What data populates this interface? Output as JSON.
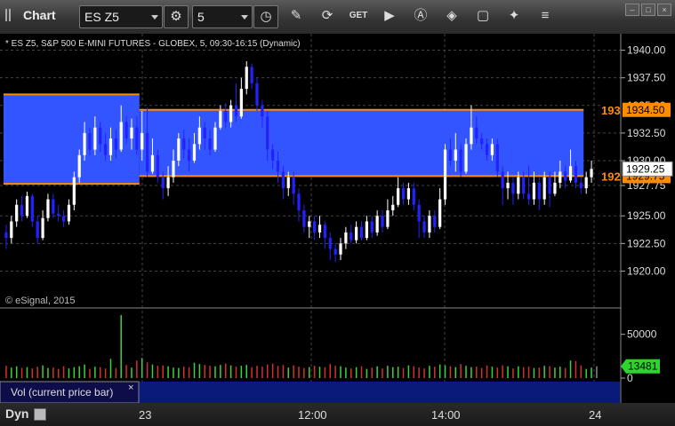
{
  "toolbar": {
    "title": "Chart",
    "symbol": "ES Z5",
    "interval": "5",
    "icons": [
      "settings-gear-icon",
      "clock-icon",
      "pencil-icon",
      "refresh-icon",
      "get-icon",
      "play-icon",
      "alert-icon",
      "tag-icon",
      "chat-icon",
      "twitter-icon",
      "menu-icon"
    ]
  },
  "chart_data": {
    "type": "candlestick",
    "title": "* ES Z5, S&P 500 E-MINI FUTURES - GLOBEX, 5, 09:30-16:15 (Dynamic)",
    "watermark": "© eSignal, 2015",
    "ylim": [
      1918.75,
      1941.25
    ],
    "yticks": [
      "1940.00",
      "1937.50",
      "1935.00",
      "1932.50",
      "1930.00",
      "1927.75",
      "1925.00",
      "1922.50",
      "1920.00"
    ],
    "xticks": [
      "23",
      "12:00",
      "14:00",
      "24"
    ],
    "last_price": "1929.25",
    "level_tag_top": "193",
    "level_tag_top_value": "1934.50",
    "level_tag_bottom": "192",
    "level_tag_bottom_value": "1929.75",
    "zones": [
      {
        "x_start": 0,
        "x_end": 26,
        "top": 1936.0,
        "bottom": 1927.9
      },
      {
        "x_start": 26,
        "x_end": 111,
        "top": 1934.6,
        "bottom": 1928.6
      }
    ],
    "candles": [
      [
        1923.5,
        1923.0,
        1924.2,
        1922.0
      ],
      [
        1923.0,
        1924.5,
        1925.0,
        1922.5
      ],
      [
        1924.5,
        1926.0,
        1926.5,
        1924.0
      ],
      [
        1926.0,
        1925.0,
        1926.8,
        1924.5
      ],
      [
        1925.0,
        1926.8,
        1927.2,
        1924.8
      ],
      [
        1926.8,
        1924.5,
        1927.0,
        1924.0
      ],
      [
        1924.5,
        1923.0,
        1925.0,
        1922.5
      ],
      [
        1923.0,
        1924.8,
        1925.5,
        1922.8
      ],
      [
        1924.8,
        1926.5,
        1927.0,
        1924.5
      ],
      [
        1926.5,
        1925.2,
        1927.0,
        1924.8
      ],
      [
        1925.2,
        1925.0,
        1926.0,
        1924.5
      ],
      [
        1925.0,
        1924.5,
        1925.5,
        1924.0
      ],
      [
        1924.5,
        1926.0,
        1926.5,
        1924.2
      ],
      [
        1926.0,
        1928.5,
        1929.0,
        1925.5
      ],
      [
        1928.5,
        1930.5,
        1931.0,
        1928.0
      ],
      [
        1930.5,
        1932.5,
        1933.5,
        1930.0
      ],
      [
        1932.5,
        1931.0,
        1933.0,
        1930.5
      ],
      [
        1931.0,
        1933.0,
        1934.0,
        1930.5
      ],
      [
        1933.0,
        1931.5,
        1933.5,
        1930.8
      ],
      [
        1931.5,
        1930.5,
        1932.5,
        1930.0
      ],
      [
        1930.5,
        1932.0,
        1933.0,
        1930.0
      ],
      [
        1932.0,
        1931.0,
        1932.8,
        1930.2
      ],
      [
        1931.0,
        1933.5,
        1935.0,
        1930.8
      ],
      [
        1933.5,
        1932.0,
        1934.0,
        1931.5
      ],
      [
        1932.0,
        1933.0,
        1933.8,
        1931.0
      ],
      [
        1933.0,
        1931.0,
        1934.0,
        1930.5
      ],
      [
        1931.0,
        1932.5,
        1934.5,
        1930.0
      ],
      [
        1932.5,
        1929.0,
        1934.8,
        1928.5
      ],
      [
        1929.0,
        1930.5,
        1932.0,
        1928.8
      ],
      [
        1930.5,
        1928.5,
        1931.0,
        1928.0
      ],
      [
        1928.5,
        1927.5,
        1929.0,
        1926.5
      ],
      [
        1927.5,
        1928.5,
        1929.5,
        1926.8
      ],
      [
        1928.5,
        1930.0,
        1931.0,
        1928.0
      ],
      [
        1930.0,
        1932.0,
        1932.5,
        1929.5
      ],
      [
        1932.0,
        1931.0,
        1932.8,
        1930.2
      ],
      [
        1931.0,
        1930.0,
        1932.0,
        1929.0
      ],
      [
        1930.0,
        1931.5,
        1932.5,
        1929.8
      ],
      [
        1931.5,
        1933.0,
        1934.0,
        1931.0
      ],
      [
        1933.0,
        1932.0,
        1933.5,
        1931.0
      ],
      [
        1932.0,
        1931.0,
        1932.8,
        1930.5
      ],
      [
        1931.0,
        1933.0,
        1933.5,
        1930.8
      ],
      [
        1933.0,
        1934.5,
        1935.0,
        1932.8
      ],
      [
        1934.5,
        1933.5,
        1935.2,
        1933.0
      ],
      [
        1933.5,
        1935.0,
        1935.5,
        1933.0
      ],
      [
        1935.0,
        1934.0,
        1937.0,
        1933.5
      ],
      [
        1934.0,
        1936.5,
        1937.5,
        1933.8
      ],
      [
        1936.5,
        1938.5,
        1939.0,
        1936.0
      ],
      [
        1938.5,
        1937.0,
        1938.8,
        1936.5
      ],
      [
        1937.0,
        1935.0,
        1937.5,
        1934.5
      ],
      [
        1935.0,
        1934.0,
        1935.5,
        1933.0
      ],
      [
        1934.0,
        1931.0,
        1934.5,
        1930.0
      ],
      [
        1931.0,
        1930.0,
        1931.5,
        1929.2
      ],
      [
        1930.0,
        1929.0,
        1930.8,
        1928.0
      ],
      [
        1929.0,
        1927.5,
        1929.5,
        1926.5
      ],
      [
        1927.5,
        1928.5,
        1929.0,
        1926.8
      ],
      [
        1928.5,
        1927.0,
        1929.0,
        1926.0
      ],
      [
        1927.0,
        1925.5,
        1927.5,
        1924.5
      ],
      [
        1925.5,
        1924.0,
        1926.0,
        1923.5
      ],
      [
        1924.0,
        1924.5,
        1925.0,
        1923.0
      ],
      [
        1924.5,
        1923.5,
        1925.0,
        1922.8
      ],
      [
        1923.5,
        1924.2,
        1925.0,
        1923.0
      ],
      [
        1924.2,
        1923.0,
        1924.5,
        1922.0
      ],
      [
        1923.0,
        1922.0,
        1923.5,
        1921.0
      ],
      [
        1922.0,
        1921.5,
        1922.5,
        1920.8
      ],
      [
        1921.5,
        1922.5,
        1923.0,
        1921.0
      ],
      [
        1922.5,
        1923.5,
        1924.0,
        1922.0
      ],
      [
        1923.5,
        1922.8,
        1924.2,
        1922.5
      ],
      [
        1922.8,
        1924.0,
        1924.5,
        1922.5
      ],
      [
        1924.0,
        1923.0,
        1924.5,
        1922.8
      ],
      [
        1923.0,
        1924.5,
        1925.0,
        1922.8
      ],
      [
        1924.5,
        1923.5,
        1925.0,
        1923.0
      ],
      [
        1923.5,
        1925.0,
        1925.5,
        1923.2
      ],
      [
        1925.0,
        1924.0,
        1925.5,
        1923.5
      ],
      [
        1924.0,
        1925.5,
        1926.5,
        1923.8
      ],
      [
        1925.5,
        1926.0,
        1926.8,
        1925.0
      ],
      [
        1926.0,
        1927.5,
        1928.5,
        1925.8
      ],
      [
        1927.5,
        1926.5,
        1928.0,
        1926.0
      ],
      [
        1926.5,
        1927.5,
        1928.0,
        1926.0
      ],
      [
        1927.5,
        1926.0,
        1928.0,
        1925.5
      ],
      [
        1926.0,
        1924.5,
        1926.5,
        1923.0
      ],
      [
        1924.5,
        1923.5,
        1925.0,
        1923.0
      ],
      [
        1923.5,
        1925.0,
        1925.5,
        1923.0
      ],
      [
        1925.0,
        1924.0,
        1925.5,
        1923.5
      ],
      [
        1924.0,
        1926.5,
        1927.5,
        1923.8
      ],
      [
        1926.5,
        1931.0,
        1931.5,
        1926.0
      ],
      [
        1931.0,
        1930.0,
        1932.0,
        1929.5
      ],
      [
        1930.0,
        1931.0,
        1932.5,
        1929.0
      ],
      [
        1931.0,
        1929.0,
        1931.5,
        1928.5
      ],
      [
        1929.0,
        1931.5,
        1932.0,
        1928.8
      ],
      [
        1931.5,
        1933.0,
        1935.0,
        1931.0
      ],
      [
        1933.0,
        1932.0,
        1934.0,
        1931.5
      ],
      [
        1932.0,
        1931.5,
        1932.5,
        1931.0
      ],
      [
        1931.5,
        1930.5,
        1932.0,
        1930.0
      ],
      [
        1930.5,
        1931.5,
        1932.0,
        1930.0
      ],
      [
        1931.5,
        1929.0,
        1932.0,
        1928.5
      ],
      [
        1929.0,
        1927.5,
        1929.5,
        1926.0
      ],
      [
        1927.5,
        1928.0,
        1929.0,
        1926.5
      ],
      [
        1928.0,
        1927.0,
        1928.5,
        1926.0
      ],
      [
        1927.0,
        1928.5,
        1929.0,
        1926.5
      ],
      [
        1928.5,
        1927.0,
        1929.0,
        1926.5
      ],
      [
        1927.0,
        1926.5,
        1929.5,
        1926.0
      ],
      [
        1926.5,
        1928.0,
        1929.0,
        1926.0
      ],
      [
        1928.0,
        1926.5,
        1928.5,
        1925.5
      ],
      [
        1926.5,
        1928.5,
        1929.0,
        1926.0
      ],
      [
        1928.5,
        1927.0,
        1929.0,
        1925.8
      ],
      [
        1927.0,
        1928.0,
        1929.0,
        1926.8
      ],
      [
        1928.0,
        1929.0,
        1930.0,
        1927.5
      ],
      [
        1929.0,
        1928.2,
        1929.5,
        1927.5
      ],
      [
        1928.2,
        1929.5,
        1931.0,
        1928.0
      ],
      [
        1929.5,
        1928.0,
        1930.0,
        1927.5
      ],
      [
        1928.0,
        1927.5,
        1928.5,
        1927.0
      ],
      [
        1927.5,
        1928.5,
        1929.0,
        1927.0
      ],
      [
        1928.5,
        1929.25,
        1930.0,
        1928.0
      ]
    ],
    "volume": {
      "label": "Vol (current price bar)",
      "ylim": [
        0,
        75000
      ],
      "yticks": [
        "50000",
        "0"
      ],
      "last_value": "13481",
      "values": [
        14000,
        12000,
        13500,
        11500,
        12500,
        11000,
        13000,
        14500,
        11500,
        12000,
        10500,
        13500,
        11000,
        12500,
        13500,
        15500,
        10500,
        13000,
        12500,
        11000,
        22000,
        11500,
        72000,
        15000,
        12000,
        20000,
        23000,
        18000,
        15500,
        14000,
        14500,
        13500,
        12000,
        11500,
        13000,
        12500,
        17500,
        16000,
        15000,
        14000,
        13500,
        15000,
        16500,
        14500,
        13000,
        14000,
        15000,
        12500,
        14000,
        13000,
        15500,
        16500,
        14000,
        15000,
        12000,
        14500,
        13000,
        11500,
        12500,
        14000,
        13000,
        12500,
        16000,
        14000,
        13500,
        12000,
        11000,
        12500,
        13500,
        10500,
        12000,
        13500,
        11000,
        14000,
        12500,
        13000,
        11500,
        14500,
        13500,
        12000,
        11000,
        14000,
        13000,
        15500,
        14500,
        13500,
        12500,
        16000,
        14000,
        12500,
        13000,
        11500,
        14500,
        13000,
        12000,
        14500,
        13500,
        11000,
        13500,
        12500,
        13000,
        11500,
        12000,
        14000,
        13500,
        12000,
        13000,
        11500,
        20000,
        19500,
        14500,
        10500,
        12000,
        13481
      ],
      "colors": {
        "up": "#3bd33b",
        "down": "#d43030",
        "flat": "#888888"
      }
    }
  },
  "volume_panel": {
    "close_label": "×"
  },
  "bottom_bar": {
    "dyn_label": "Dyn"
  },
  "colors": {
    "bull": "#ffffff",
    "bear": "#2222ff",
    "zone_fill": "#3355ff",
    "zone_line": "#ff8c00",
    "price_tag_bg": "#ffffff",
    "level_tag_bg": "#ff8c00",
    "volume_tag_bg": "#2bd62b"
  }
}
